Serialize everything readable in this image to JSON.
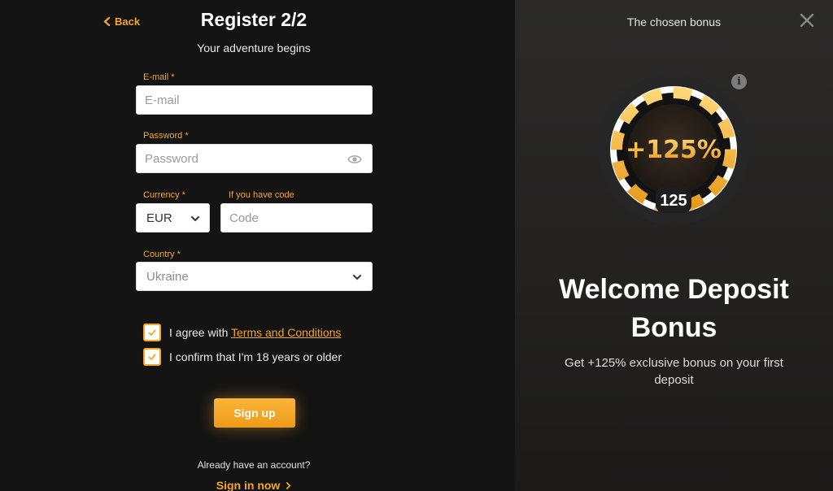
{
  "header": {
    "back_label": "Back",
    "title": "Register 2/2",
    "subtitle": "Your adventure begins"
  },
  "form": {
    "email": {
      "label": "E-mail *",
      "placeholder": "E-mail",
      "value": ""
    },
    "password": {
      "label": "Password *",
      "placeholder": "Password",
      "value": ""
    },
    "currency": {
      "label": "Currency *",
      "selected": "EUR"
    },
    "code": {
      "label": "If you have code",
      "placeholder": "Code",
      "value": ""
    },
    "country": {
      "label": "Country *",
      "selected": "Ukraine"
    },
    "terms": {
      "prefix": "I agree with ",
      "link": "Terms and Conditions",
      "checked": true
    },
    "age": {
      "label": "I confirm that I'm 18 years or older",
      "checked": true
    },
    "submit_label": "Sign up"
  },
  "footer": {
    "already": "Already have an account?",
    "signin": "Sign in now"
  },
  "bonus_panel": {
    "heading": "The chosen bonus",
    "info_glyph": "i",
    "badge_text": "+125%",
    "badge_number": "125",
    "title_line1": "Welcome Deposit",
    "title_line2": "Bonus",
    "description": "Get +125% exclusive bonus on your first deposit"
  },
  "colors": {
    "accent": "#f5a623",
    "background_left": "#141414",
    "background_right": "#272625"
  },
  "icons": [
    "chevron-left-icon",
    "eye-icon",
    "chevron-down-icon",
    "check-icon",
    "close-icon",
    "info-icon",
    "chevron-right-icon"
  ]
}
